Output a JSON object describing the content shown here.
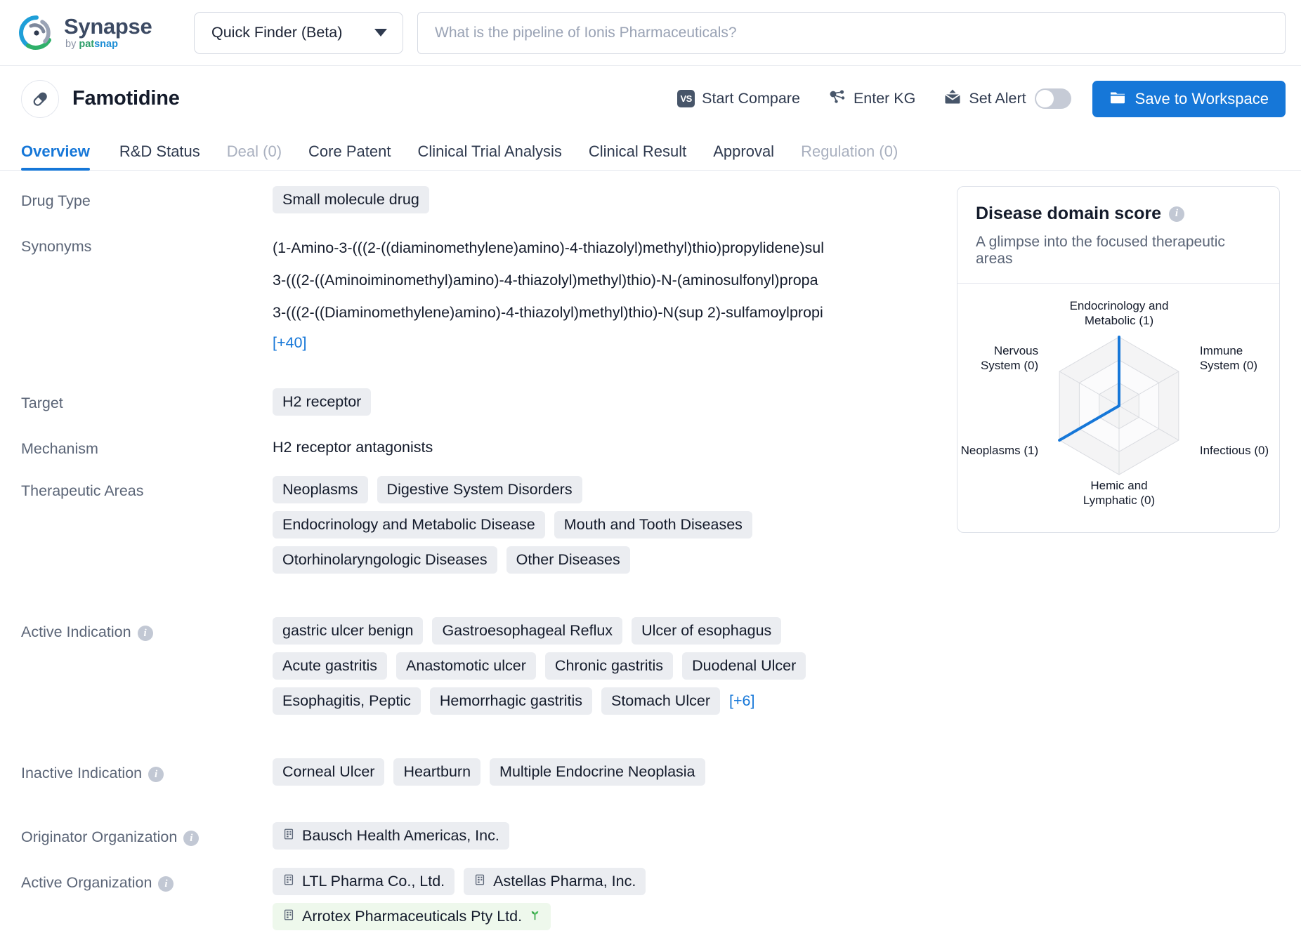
{
  "topbar": {
    "brand_name": "Synapse",
    "brand_by": "by ",
    "brand_pat": "pat",
    "brand_snap": "snap",
    "finder_label": "Quick Finder (Beta)",
    "search_value": "",
    "search_placeholder": "What is the pipeline of Ionis Pharmaceuticals?"
  },
  "drug_header": {
    "title": "Famotidine",
    "start_compare": "Start Compare",
    "vs_badge": "VS",
    "enter_kg": "Enter KG",
    "set_alert": "Set Alert",
    "save_to_workspace": "Save to Workspace",
    "alert_toggle_on": false
  },
  "tabs": [
    {
      "label": "Overview",
      "active": true,
      "dim": false
    },
    {
      "label": "R&D Status",
      "active": false,
      "dim": false
    },
    {
      "label": "Deal (0)",
      "active": false,
      "dim": true
    },
    {
      "label": "Core Patent",
      "active": false,
      "dim": false
    },
    {
      "label": "Clinical Trial Analysis",
      "active": false,
      "dim": false
    },
    {
      "label": "Clinical Result",
      "active": false,
      "dim": false
    },
    {
      "label": "Approval",
      "active": false,
      "dim": false
    },
    {
      "label": "Regulation (0)",
      "active": false,
      "dim": true
    }
  ],
  "fields": {
    "drug_type_label": "Drug Type",
    "drug_type_value": "Small molecule drug",
    "synonyms_label": "Synonyms",
    "synonyms": [
      "(1-Amino-3-(((2-((diaminomethylene)amino)-4-thiazolyl)methyl)thio)propylidene)sul",
      "3-(((2-((Aminoiminomethyl)amino)-4-thiazolyl)methyl)thio)-N-(aminosulfonyl)propa",
      "3-(((2-((Diaminomethylene)amino)-4-thiazolyl)methyl)thio)-N(sup 2)-sulfamoylpropi"
    ],
    "synonyms_more": "[+40]",
    "target_label": "Target",
    "target_values": [
      "H2 receptor"
    ],
    "mechanism_label": "Mechanism",
    "mechanism_value": "H2 receptor antagonists",
    "therapeutic_areas_label": "Therapeutic Areas",
    "therapeutic_areas": [
      "Neoplasms",
      "Digestive System Disorders",
      "Endocrinology and Metabolic Disease",
      "Mouth and Tooth Diseases",
      "Otorhinolaryngologic Diseases",
      "Other Diseases"
    ],
    "active_indication_label": "Active Indication",
    "active_indications": [
      "gastric ulcer benign",
      "Gastroesophageal Reflux",
      "Ulcer of esophagus",
      "Acute gastritis",
      "Anastomotic ulcer",
      "Chronic gastritis",
      "Duodenal Ulcer",
      "Esophagitis, Peptic",
      "Hemorrhagic gastritis",
      "Stomach Ulcer"
    ],
    "active_indications_more": "[+6]",
    "inactive_indication_label": "Inactive Indication",
    "inactive_indications": [
      "Corneal Ulcer",
      "Heartburn",
      "Multiple Endocrine Neoplasia"
    ],
    "originator_org_label": "Originator Organization",
    "originator_orgs": [
      {
        "name": "Bausch Health Americas, Inc.",
        "highlight": false,
        "sprout": false
      }
    ],
    "active_org_label": "Active Organization",
    "active_orgs": [
      {
        "name": "LTL Pharma Co., Ltd.",
        "highlight": false,
        "sprout": false
      },
      {
        "name": "Astellas Pharma, Inc.",
        "highlight": false,
        "sprout": false
      },
      {
        "name": "Arrotex Pharmaceuticals Pty Ltd.",
        "highlight": true,
        "sprout": true
      }
    ]
  },
  "disease_card": {
    "title": "Disease domain score",
    "subtitle": "A glimpse into the focused therapeutic areas"
  },
  "chart_data": {
    "type": "radar",
    "title": "Disease domain score",
    "subtitle": "A glimpse into the focused therapeutic areas",
    "categories": [
      "Endocrinology and Metabolic",
      "Immune System",
      "Infectious",
      "Hemic and Lymphatic",
      "Neoplasms",
      "Nervous System"
    ],
    "labels": [
      "Endocrinology and\nMetabolic (1)",
      "Immune\nSystem (0)",
      "Infectious (0)",
      "Hemic and\nLymphatic (0)",
      "Neoplasms (1)",
      "Nervous\nSystem (0)"
    ],
    "values": [
      1,
      0,
      0,
      0,
      1,
      0
    ],
    "rmax": 1,
    "rings": 3,
    "grid": true,
    "legend": "none",
    "series_color": "#1677d8",
    "grid_color": "#d9dbe0"
  },
  "colors": {
    "accent": "#1677d8",
    "chip_bg": "#ebedf1",
    "chip_green_bg": "#eef8ec",
    "label_text": "#5b6577",
    "body_text": "#141b2b",
    "border": "#e7e9ef"
  },
  "icons": {
    "logo": "synapse-logo-icon",
    "caret": "chevron-down-icon",
    "pill": "pill-icon",
    "kg": "knowledge-graph-icon",
    "alert": "alert-envelope-icon",
    "folder": "folder-icon",
    "building": "building-icon",
    "sprout": "sprout-icon",
    "info": "info-icon"
  }
}
